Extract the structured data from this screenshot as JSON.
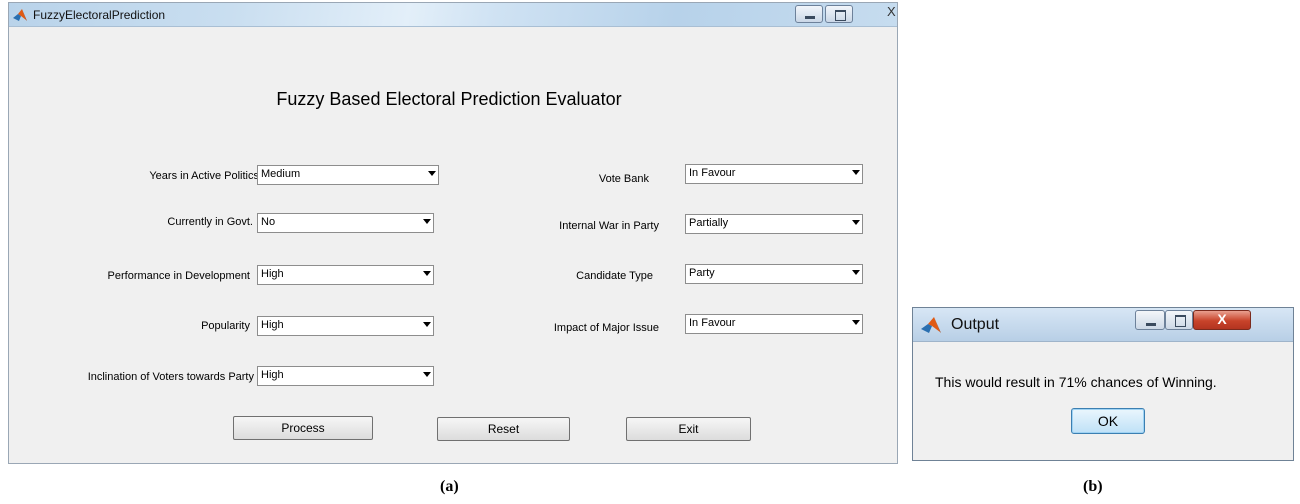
{
  "main_window": {
    "title": "FuzzyElectoralPrediction",
    "heading": "Fuzzy Based Electoral Prediction Evaluator",
    "close_glyph": "X",
    "left_fields": [
      {
        "label": "Years in Active Politics",
        "value": "Medium"
      },
      {
        "label": "Currently in Govt.",
        "value": "No"
      },
      {
        "label": "Performance in Development",
        "value": "High"
      },
      {
        "label": "Popularity",
        "value": "High"
      },
      {
        "label": "Inclination of Voters towards Party",
        "value": "High"
      }
    ],
    "right_fields": [
      {
        "label": "Vote Bank",
        "value": "In Favour"
      },
      {
        "label": "Internal War in Party",
        "value": "Partially"
      },
      {
        "label": "Candidate Type",
        "value": "Party"
      },
      {
        "label": "Impact of Major Issue",
        "value": "In Favour"
      }
    ],
    "buttons": {
      "process": "Process",
      "reset": "Reset",
      "exit": "Exit"
    }
  },
  "output_dialog": {
    "title": "Output",
    "message": "This would result in 71% chances of Winning.",
    "ok": "OK",
    "close_glyph": "X"
  },
  "captions": {
    "a": "(a)",
    "b": "(b)"
  },
  "icons": {
    "app": "matlab-icon",
    "dialog": "matlab-icon"
  },
  "colors": {
    "window_bg": "#f0f0f0",
    "close_button": "#c8432a",
    "ok_border": "#3c7fb1"
  }
}
